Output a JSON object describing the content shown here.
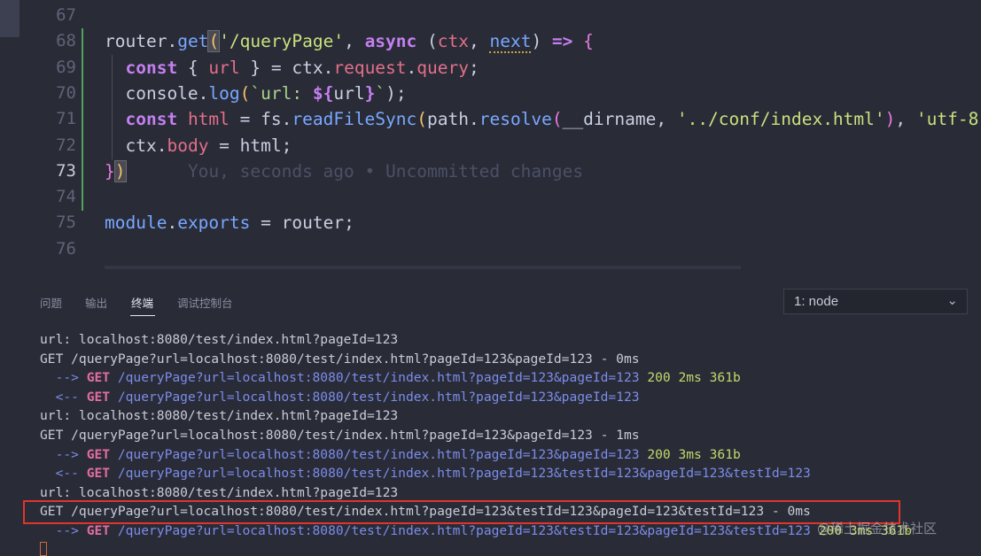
{
  "editor": {
    "lines": [
      {
        "num": "67",
        "segments": []
      },
      {
        "num": "68",
        "segments": [
          {
            "t": "router",
            "c": "var"
          },
          {
            "t": ".",
            "c": "punc"
          },
          {
            "t": "get",
            "c": "fn"
          },
          {
            "t": "(",
            "c": "bracket-hl"
          },
          {
            "t": "'/queryPage'",
            "c": "str"
          },
          {
            "t": ", ",
            "c": "punc"
          },
          {
            "t": "async",
            "c": "kw"
          },
          {
            "t": " (",
            "c": "punc"
          },
          {
            "t": "ctx",
            "c": "prop"
          },
          {
            "t": ", ",
            "c": "punc"
          },
          {
            "t": "next",
            "c": "warn"
          },
          {
            "t": ") ",
            "c": "punc"
          },
          {
            "t": "=>",
            "c": "kw"
          },
          {
            "t": " {",
            "c": "paren2"
          }
        ]
      },
      {
        "num": "69",
        "segments": [
          {
            "t": "  ",
            "c": "punc"
          },
          {
            "t": "const",
            "c": "kw"
          },
          {
            "t": " { ",
            "c": "punc"
          },
          {
            "t": "url",
            "c": "prop"
          },
          {
            "t": " } = ",
            "c": "punc"
          },
          {
            "t": "ctx",
            "c": "var"
          },
          {
            "t": ".",
            "c": "punc"
          },
          {
            "t": "request",
            "c": "prop"
          },
          {
            "t": ".",
            "c": "punc"
          },
          {
            "t": "query",
            "c": "prop"
          },
          {
            "t": ";",
            "c": "punc"
          }
        ]
      },
      {
        "num": "70",
        "segments": [
          {
            "t": "  ",
            "c": "punc"
          },
          {
            "t": "console",
            "c": "var"
          },
          {
            "t": ".",
            "c": "punc"
          },
          {
            "t": "log",
            "c": "fn"
          },
          {
            "t": "(",
            "c": "paren"
          },
          {
            "t": "`url: ",
            "c": "tmpl"
          },
          {
            "t": "${",
            "c": "kw"
          },
          {
            "t": "url",
            "c": "var"
          },
          {
            "t": "}",
            "c": "kw"
          },
          {
            "t": "`",
            "c": "tmpl"
          },
          {
            "t": ");",
            "c": "punc"
          }
        ]
      },
      {
        "num": "71",
        "segments": [
          {
            "t": "  ",
            "c": "punc"
          },
          {
            "t": "const",
            "c": "kw"
          },
          {
            "t": " ",
            "c": "punc"
          },
          {
            "t": "html",
            "c": "prop"
          },
          {
            "t": " = ",
            "c": "punc"
          },
          {
            "t": "fs",
            "c": "var"
          },
          {
            "t": ".",
            "c": "punc"
          },
          {
            "t": "readFileSync",
            "c": "fn"
          },
          {
            "t": "(",
            "c": "paren"
          },
          {
            "t": "path",
            "c": "var"
          },
          {
            "t": ".",
            "c": "punc"
          },
          {
            "t": "resolve",
            "c": "fn"
          },
          {
            "t": "(",
            "c": "paren2"
          },
          {
            "t": "__dirname",
            "c": "var"
          },
          {
            "t": ", ",
            "c": "punc"
          },
          {
            "t": "'../conf/index.html'",
            "c": "str"
          },
          {
            "t": ")",
            "c": "paren2"
          },
          {
            "t": ", ",
            "c": "punc"
          },
          {
            "t": "'utf-8",
            "c": "str"
          }
        ]
      },
      {
        "num": "72",
        "segments": [
          {
            "t": "  ",
            "c": "punc"
          },
          {
            "t": "ctx",
            "c": "var"
          },
          {
            "t": ".",
            "c": "punc"
          },
          {
            "t": "body",
            "c": "prop"
          },
          {
            "t": " = ",
            "c": "punc"
          },
          {
            "t": "html",
            "c": "var"
          },
          {
            "t": ";",
            "c": "punc"
          }
        ]
      },
      {
        "num": "73",
        "active": true,
        "segments": [
          {
            "t": "}",
            "c": "paren2"
          },
          {
            "t": ")",
            "c": "bracket-hl"
          },
          {
            "t": "      You, seconds ago • Uncommitted changes",
            "c": "blame"
          }
        ]
      },
      {
        "num": "74",
        "segments": []
      },
      {
        "num": "75",
        "segments": [
          {
            "t": "module",
            "c": "fn"
          },
          {
            "t": ".",
            "c": "punc"
          },
          {
            "t": "exports",
            "c": "fn"
          },
          {
            "t": " = ",
            "c": "punc"
          },
          {
            "t": "router",
            "c": "var"
          },
          {
            "t": ";",
            "c": "punc"
          }
        ]
      },
      {
        "num": "76",
        "segments": []
      }
    ]
  },
  "panel": {
    "tabs": [
      "问题",
      "输出",
      "终端",
      "调试控制台"
    ],
    "active_tab": "终端",
    "terminal_select": "1: node",
    "lines": [
      [
        {
          "t": "url: localhost:8080/test/index.html?pageId=123",
          "c": "plain"
        }
      ],
      [
        {
          "t": "GET /queryPage?url=localhost:8080/test/index.html?pageId=123&pageId=123 - 0ms",
          "c": "plain"
        }
      ],
      [
        {
          "t": "  --> ",
          "c": "arrow"
        },
        {
          "t": "GET",
          "c": "method"
        },
        {
          "t": " /queryPage?url=localhost:8080/test/index.html?pageId=123&pageId=123",
          "c": "path"
        },
        {
          "t": " 200",
          "c": "ok"
        },
        {
          "t": " 2ms",
          "c": "time"
        },
        {
          "t": " 361b",
          "c": "size"
        }
      ],
      [
        {
          "t": "  <-- ",
          "c": "arrow"
        },
        {
          "t": "GET",
          "c": "method"
        },
        {
          "t": " /queryPage?url=localhost:8080/test/index.html?pageId=123&pageId=123",
          "c": "path"
        }
      ],
      [
        {
          "t": "url: localhost:8080/test/index.html?pageId=123",
          "c": "plain"
        }
      ],
      [
        {
          "t": "GET /queryPage?url=localhost:8080/test/index.html?pageId=123&pageId=123 - 1ms",
          "c": "plain"
        }
      ],
      [
        {
          "t": "  --> ",
          "c": "arrow"
        },
        {
          "t": "GET",
          "c": "method"
        },
        {
          "t": " /queryPage?url=localhost:8080/test/index.html?pageId=123&pageId=123",
          "c": "path"
        },
        {
          "t": " 200",
          "c": "ok"
        },
        {
          "t": " 3ms",
          "c": "time"
        },
        {
          "t": " 361b",
          "c": "size"
        }
      ],
      [
        {
          "t": "  <-- ",
          "c": "arrow"
        },
        {
          "t": "GET",
          "c": "method"
        },
        {
          "t": " /queryPage?url=localhost:8080/test/index.html?pageId=123&testId=123&pageId=123&testId=123",
          "c": "path"
        }
      ],
      [
        {
          "t": "url: localhost:8080/test/index.html?pageId=123",
          "c": "plain"
        }
      ],
      [
        {
          "t": "GET /queryPage?url=localhost:8080/test/index.html?pageId=123&testId=123&pageId=123&testId=123 - 0ms",
          "c": "plain"
        }
      ],
      [
        {
          "t": "  --> ",
          "c": "arrow"
        },
        {
          "t": "GET",
          "c": "method"
        },
        {
          "t": " /queryPage?url=localhost:8080/test/index.html?pageId=123&testId=123&pageId=123&testId=123",
          "c": "path"
        },
        {
          "t": " 200",
          "c": "ok"
        },
        {
          "t": " 3ms",
          "c": "time"
        },
        {
          "t": " 361b",
          "c": "size"
        }
      ]
    ],
    "watermark": "@稀土掘金技术社区"
  },
  "colors": {
    "highlight_box": "#e0352c",
    "git_added": "#4fa35a"
  }
}
